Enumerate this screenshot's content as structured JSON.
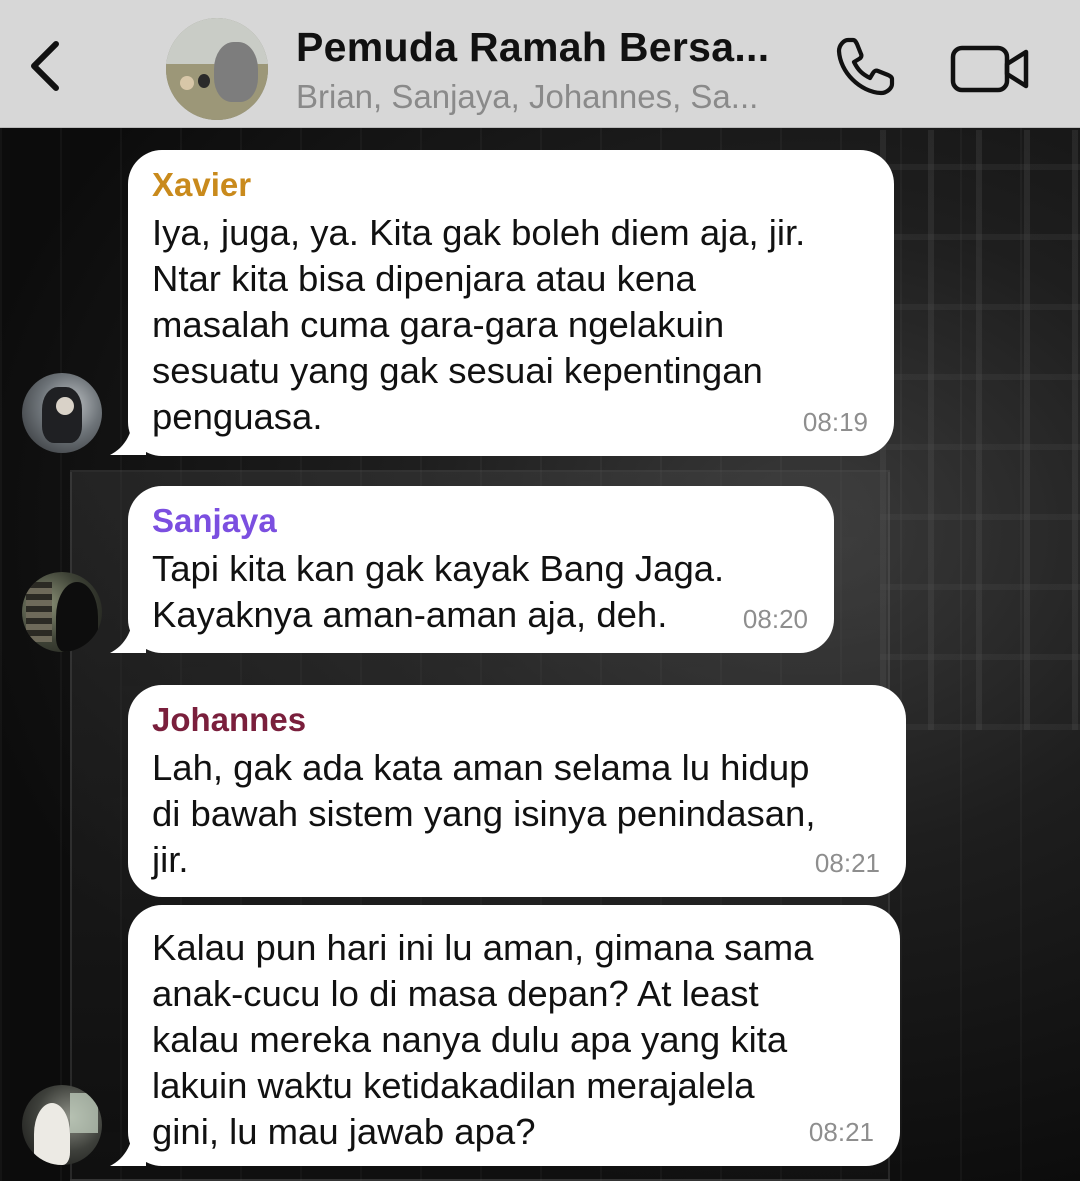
{
  "header": {
    "title": "Pemuda Ramah Bersa...",
    "subtitle": "Brian, Sanjaya, Johannes, Sa..."
  },
  "colors": {
    "xavier": "#c98a1c",
    "sanjaya": "#7b4fe0",
    "johannes": "#7a1f3c",
    "bubble": "#ffffff",
    "header_bg": "#d7d7d7"
  },
  "messages": [
    {
      "sender": "Xavier",
      "text": "Iya, juga, ya. Kita gak boleh diem aja, jir.\nNtar kita bisa dipenjara atau kena\nmasalah cuma gara-gara ngelakuin\nsesuatu yang gak sesuai kepentingan\npenguasa.",
      "time": "08:19"
    },
    {
      "sender": "Sanjaya",
      "text": "Tapi kita kan gak kayak Bang Jaga.\nKayaknya aman-aman aja, deh.",
      "time": "08:20"
    },
    {
      "sender": "Johannes",
      "text": "Lah, gak ada kata aman selama lu hidup\ndi bawah sistem yang isinya penindasan,\njir.",
      "time": "08:21"
    },
    {
      "sender": "",
      "text": "Kalau pun hari ini lu aman, gimana sama\nanak-cucu lo di masa depan? At least\nkalau mereka nanya dulu apa yang kita\nlakuin waktu ketidakadilan merajalela\ngini, lu mau jawab apa?",
      "time": "08:21"
    }
  ]
}
